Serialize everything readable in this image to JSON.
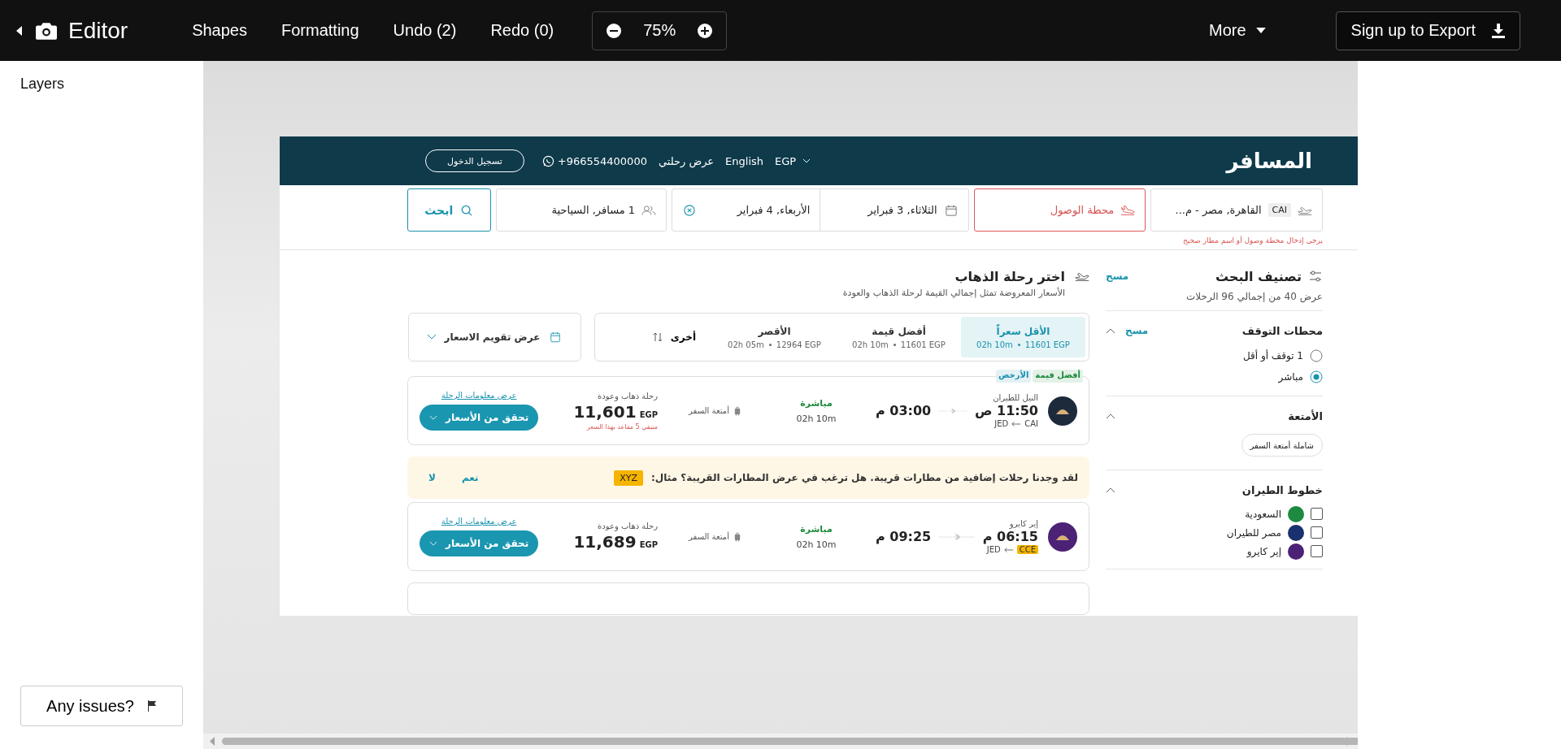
{
  "editor": {
    "title": "Editor",
    "shapes_button": "Shapes",
    "formatting_button": "Formatting",
    "undo_button": "Undo (2)",
    "redo_button": "Redo (0)",
    "zoom": "75%",
    "more": "More",
    "export_button": "Sign up to Export"
  },
  "layers_panel": {
    "title": "Layers",
    "issues_button": "Any issues?"
  },
  "site": {
    "logo": "المسافر",
    "login_button": "تسجيل الدخول",
    "phone": "+966554400000",
    "my_booking": "عرض رحلتي",
    "language": "English",
    "currency": "EGP"
  },
  "search": {
    "origin_code": "CAI",
    "origin": "القاهرة, مصر - م...",
    "destination_placeholder": "محطة الوصول",
    "destination_error": true,
    "error_text": "يرجى إدخال محطة وصول أو اسم مطار صحيح",
    "depart_date": "الثلاثاء, 3 فبراير",
    "return_date": "الأربعاء, 4 فبراير",
    "travellers": "1 مسافر, السياحية",
    "search_button": "ابحث"
  },
  "filters": {
    "title": "تصنيف البحث",
    "clear": "مسح",
    "summary": "عرض 40 من إجمالي 96 الرحلات",
    "sections": [
      {
        "kind": "radio",
        "title": "محطات التوقف",
        "clear": "مسح",
        "expanded": true,
        "options": [
          {
            "label": "1 توقف أو أقل",
            "selected": false
          },
          {
            "label": "مباشر",
            "selected": true
          }
        ]
      },
      {
        "kind": "chips",
        "title": "الأمتعة",
        "expanded": true,
        "options": [
          {
            "label": "شاملة أمتعة السفر",
            "selected": false
          }
        ]
      },
      {
        "kind": "checkbox",
        "title": "خطوط الطيران",
        "expanded": true,
        "options": [
          {
            "label": "السعودية",
            "checked": false,
            "color": "#1d8a3f"
          },
          {
            "label": "مصر للطيران",
            "checked": false,
            "color": "#1a3170"
          },
          {
            "label": "إير كايرو",
            "checked": false,
            "color": "#4b2275"
          }
        ]
      }
    ]
  },
  "results": {
    "title": "اختر رحلة الذهاب",
    "subtitle": "الأسعار المعروضة تمثل إجمالي القيمة لرحلة الذهاب والعودة",
    "sort_tabs": [
      {
        "label": "الأقل سعراً",
        "duration": "02h 10m",
        "price": "11601 EGP",
        "selected": true
      },
      {
        "label": "أفضل قيمة",
        "duration": "02h 10m",
        "price": "11601 EGP",
        "selected": false
      },
      {
        "label": "الأقصر",
        "duration": "02h 05m",
        "price": "12964 EGP",
        "selected": false
      }
    ],
    "sort_other": "أخرى",
    "calendar_button": "عرض تقويم الاسعار"
  },
  "flights": [
    {
      "badges": [
        {
          "label": "أفضل قيمة",
          "color": "#1a8a3a"
        },
        {
          "label": "الأرخص",
          "color": "#1a8fb0"
        }
      ],
      "airline": "النيل للطيران",
      "color": "#1c2a3c",
      "depart": "11:50 ص",
      "arrive": "03:00 م",
      "from": "CAI",
      "from_highlight": false,
      "to": "JED",
      "stops": "مباشرة",
      "duration": "02h 10m",
      "baggage": "أمتعة السفر",
      "fare_label": "رحلة ذهاب وعودة",
      "price": "11,601",
      "currency": "EGP",
      "seats_left": "متبقي 5 مقاعد بهذا السعر",
      "details_link": "عرض معلومات الرحلة",
      "check_button": "تحقق من الأسعار"
    },
    {
      "airline": "إير كايرو",
      "color": "#4b2275",
      "depart": "06:15 م",
      "arrive": "09:25 م",
      "from": "CCE",
      "from_highlight": true,
      "to": "JED",
      "stops": "مباشرة",
      "duration": "02h 10m",
      "baggage": "أمتعة السفر",
      "fare_label": "رحلة ذهاب وعودة",
      "price": "11,689",
      "currency": "EGP",
      "details_link": "عرض معلومات الرحلة",
      "check_button": "تحقق من الأسعار"
    }
  ],
  "nearby_banner": {
    "text": "لقد وجدنا رحلات إضافية من مطارات قريبة. هل ترغب في عرض المطارات القريبة؟ مثال:",
    "code": "XYZ",
    "yes": "نعم",
    "no": "لا"
  }
}
